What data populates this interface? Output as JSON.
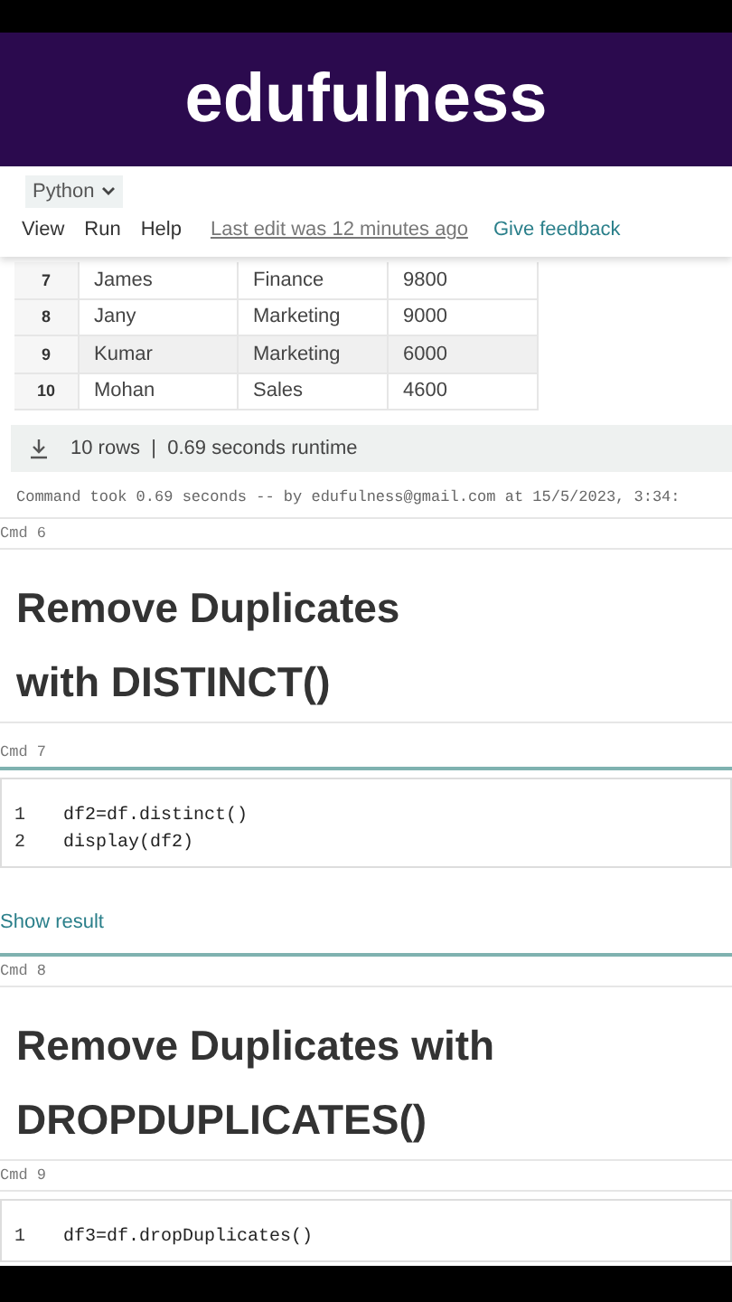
{
  "banner": {
    "title": "edufulness"
  },
  "toolbar": {
    "language": "Python",
    "menu": [
      "View",
      "Run",
      "Help"
    ],
    "last_edit": "Last edit was 12 minutes ago",
    "feedback": "Give feedback"
  },
  "table": {
    "rows": [
      {
        "index": "7",
        "name": "James",
        "department": "Finance",
        "salary": "9800",
        "highlighted": false
      },
      {
        "index": "8",
        "name": "Jany",
        "department": "Marketing",
        "salary": "9000",
        "highlighted": false
      },
      {
        "index": "9",
        "name": "Kumar",
        "department": "Marketing",
        "salary": "6000",
        "highlighted": true
      },
      {
        "index": "10",
        "name": "Mohan",
        "department": "Sales",
        "salary": "4600",
        "highlighted": false
      }
    ],
    "summary": "10 rows  |  0.69 seconds runtime"
  },
  "command_info": "Command took 0.69 seconds -- by edufulness@gmail.com at 15/5/2023, 3:34:",
  "cells": [
    {
      "kind": "markdown",
      "label": "Cmd 6",
      "lines": [
        "Remove Duplicates",
        "with DISTINCT()"
      ]
    },
    {
      "kind": "code",
      "label": "Cmd 7",
      "focused": true,
      "code": [
        {
          "number": "1",
          "text": "df2=df.distinct()"
        },
        {
          "number": "2",
          "text": "display(df2)"
        }
      ],
      "show_result": "Show result"
    },
    {
      "kind": "markdown",
      "label": "Cmd 8",
      "lines": [
        "Remove Duplicates with",
        "DROPDUPLICATES()"
      ]
    },
    {
      "kind": "code",
      "label": "Cmd 9",
      "focused": false,
      "code": [
        {
          "number": "1",
          "text": "df3=df.dropDuplicates()"
        }
      ]
    }
  ]
}
